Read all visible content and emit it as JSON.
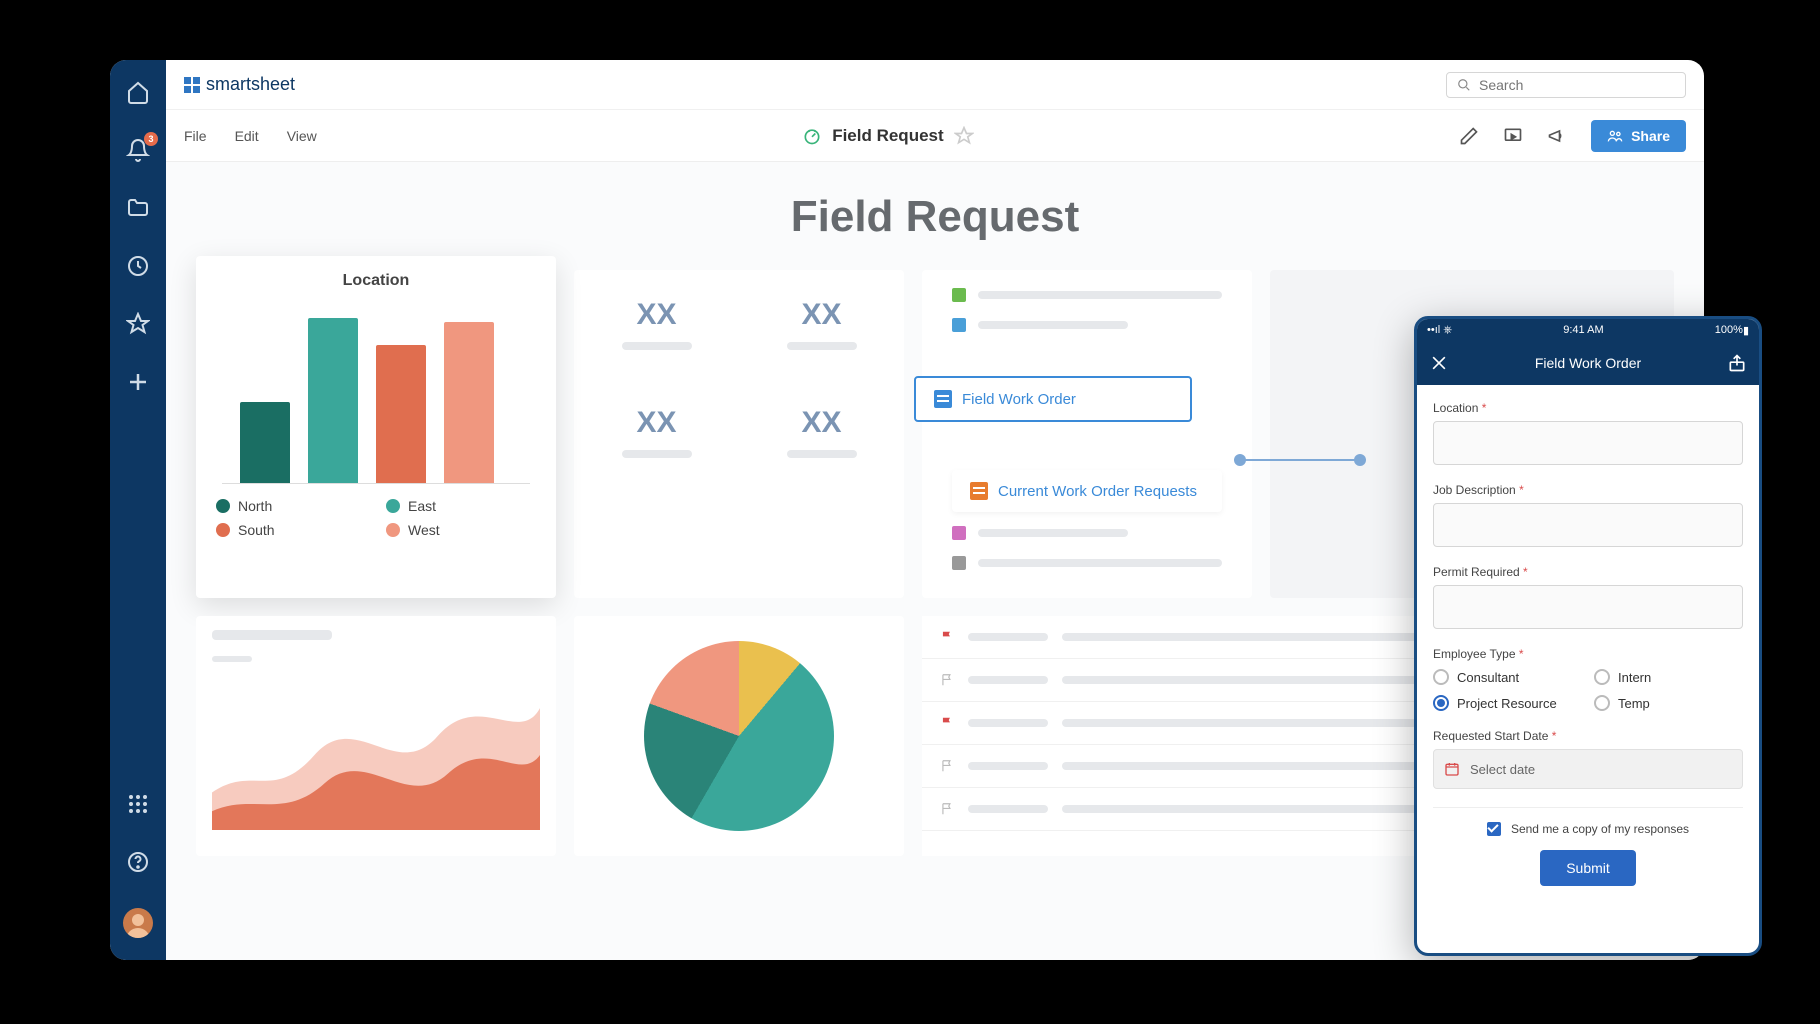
{
  "app": {
    "name": "smartsheet"
  },
  "search": {
    "placeholder": "Search"
  },
  "sidebar": {
    "notif_count": "3"
  },
  "menu": {
    "file": "File",
    "edit": "Edit",
    "view": "View"
  },
  "doc": {
    "title": "Field Request",
    "page_heading": "Field Request"
  },
  "share_button": "Share",
  "location_card": {
    "title": "Location",
    "legend": [
      "North",
      "East",
      "South",
      "West"
    ]
  },
  "chart_data": {
    "type": "bar",
    "title": "Location",
    "categories": [
      "North",
      "East",
      "South",
      "West"
    ],
    "series": [
      {
        "name": "Location",
        "values": [
          45,
          92,
          77,
          90
        ],
        "colors": [
          "#1a6e63",
          "#3aa79a",
          "#e06e4f",
          "#f0977f"
        ]
      }
    ],
    "ylim": [
      0,
      100
    ],
    "xlabel": "",
    "ylabel": ""
  },
  "stat_placeholder": "XX",
  "wo": {
    "link1": "Field Work Order",
    "link2": "Current Work Order Requests"
  },
  "mobile": {
    "status": {
      "signal": "📶",
      "time": "9:41 AM",
      "battery": "100%"
    },
    "title": "Field Work Order",
    "fields": {
      "location": "Location",
      "job": "Job Description",
      "permit": "Permit Required",
      "emp": "Employee Type",
      "start": "Requested Start Date"
    },
    "emp_options": [
      "Consultant",
      "Intern",
      "Project Resource",
      "Temp"
    ],
    "emp_selected": "Project Resource",
    "date_placeholder": "Select date",
    "copy_label": "Send me a copy of my responses",
    "submit": "Submit"
  }
}
